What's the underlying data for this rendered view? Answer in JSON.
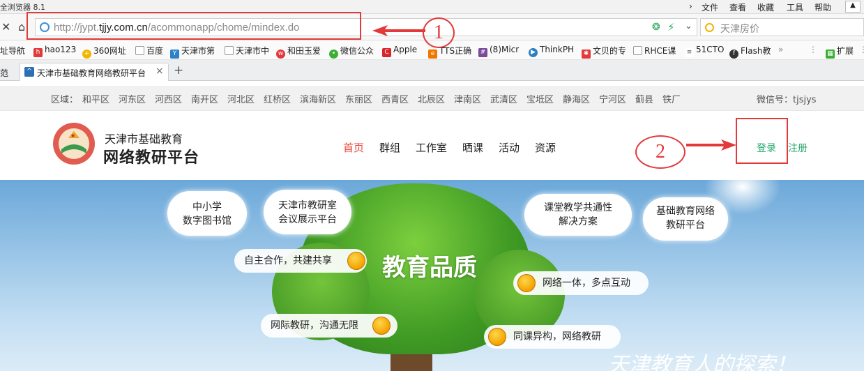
{
  "browser": {
    "title": "全浏览器 8.1",
    "menu": [
      "文件",
      "查看",
      "收藏",
      "工具",
      "帮助"
    ],
    "url_prefix": "http://jypt.",
    "url_domain": "tjjy.com.cn",
    "url_path": "/acommonapp/chome/mindex.do",
    "search_placeholder": "天津房价",
    "bookmarks": [
      "址导航",
      "hao123",
      "360网址",
      "百度",
      "天津市第",
      "天津市中",
      "和田玉爱",
      "微信公众",
      "Apple",
      "TTS正确",
      "(8)Micr",
      "ThinkPH",
      "文贝的专",
      "RHCE课",
      "51CTO",
      "Flash教",
      "扩展"
    ],
    "tab_left_label": "范",
    "tab_title": "天津市基础教育网络教研平台",
    "tab_close": "×",
    "new_tab": "+"
  },
  "site": {
    "region_label": "区域：",
    "regions": [
      "和平区",
      "河东区",
      "河西区",
      "南开区",
      "河北区",
      "红桥区",
      "滨海新区",
      "东丽区",
      "西青区",
      "北辰区",
      "津南区",
      "武清区",
      "宝坻区",
      "静海区",
      "宁河区",
      "蓟县",
      "铁厂"
    ],
    "wechat": "微信号：tjsjys",
    "logo_line1": "天津市基础教育",
    "logo_line2": "网络教研平台",
    "nav": [
      "首页",
      "群组",
      "工作室",
      "晒课",
      "活动",
      "资源"
    ],
    "login": "登录",
    "register": "注册"
  },
  "banner": {
    "clouds": [
      "中小学\n数字图书馆",
      "天津市教研室\n会议展示平台",
      "课堂教学共通性\n解决方案",
      "基础教育网络\n教研平台"
    ],
    "slogan": "教育品质",
    "pills": [
      "自主合作，共建共享",
      "网络一体，多点互动",
      "网际教研，沟通无限",
      "同课异构，网络教研"
    ],
    "handwriting": "天津教育人的探索！"
  },
  "annotations": {
    "one": "1",
    "two": "2"
  },
  "colors": {
    "accent_red": "#e2393a",
    "nav_active": "#e8473c",
    "login_green": "#2aa870"
  }
}
